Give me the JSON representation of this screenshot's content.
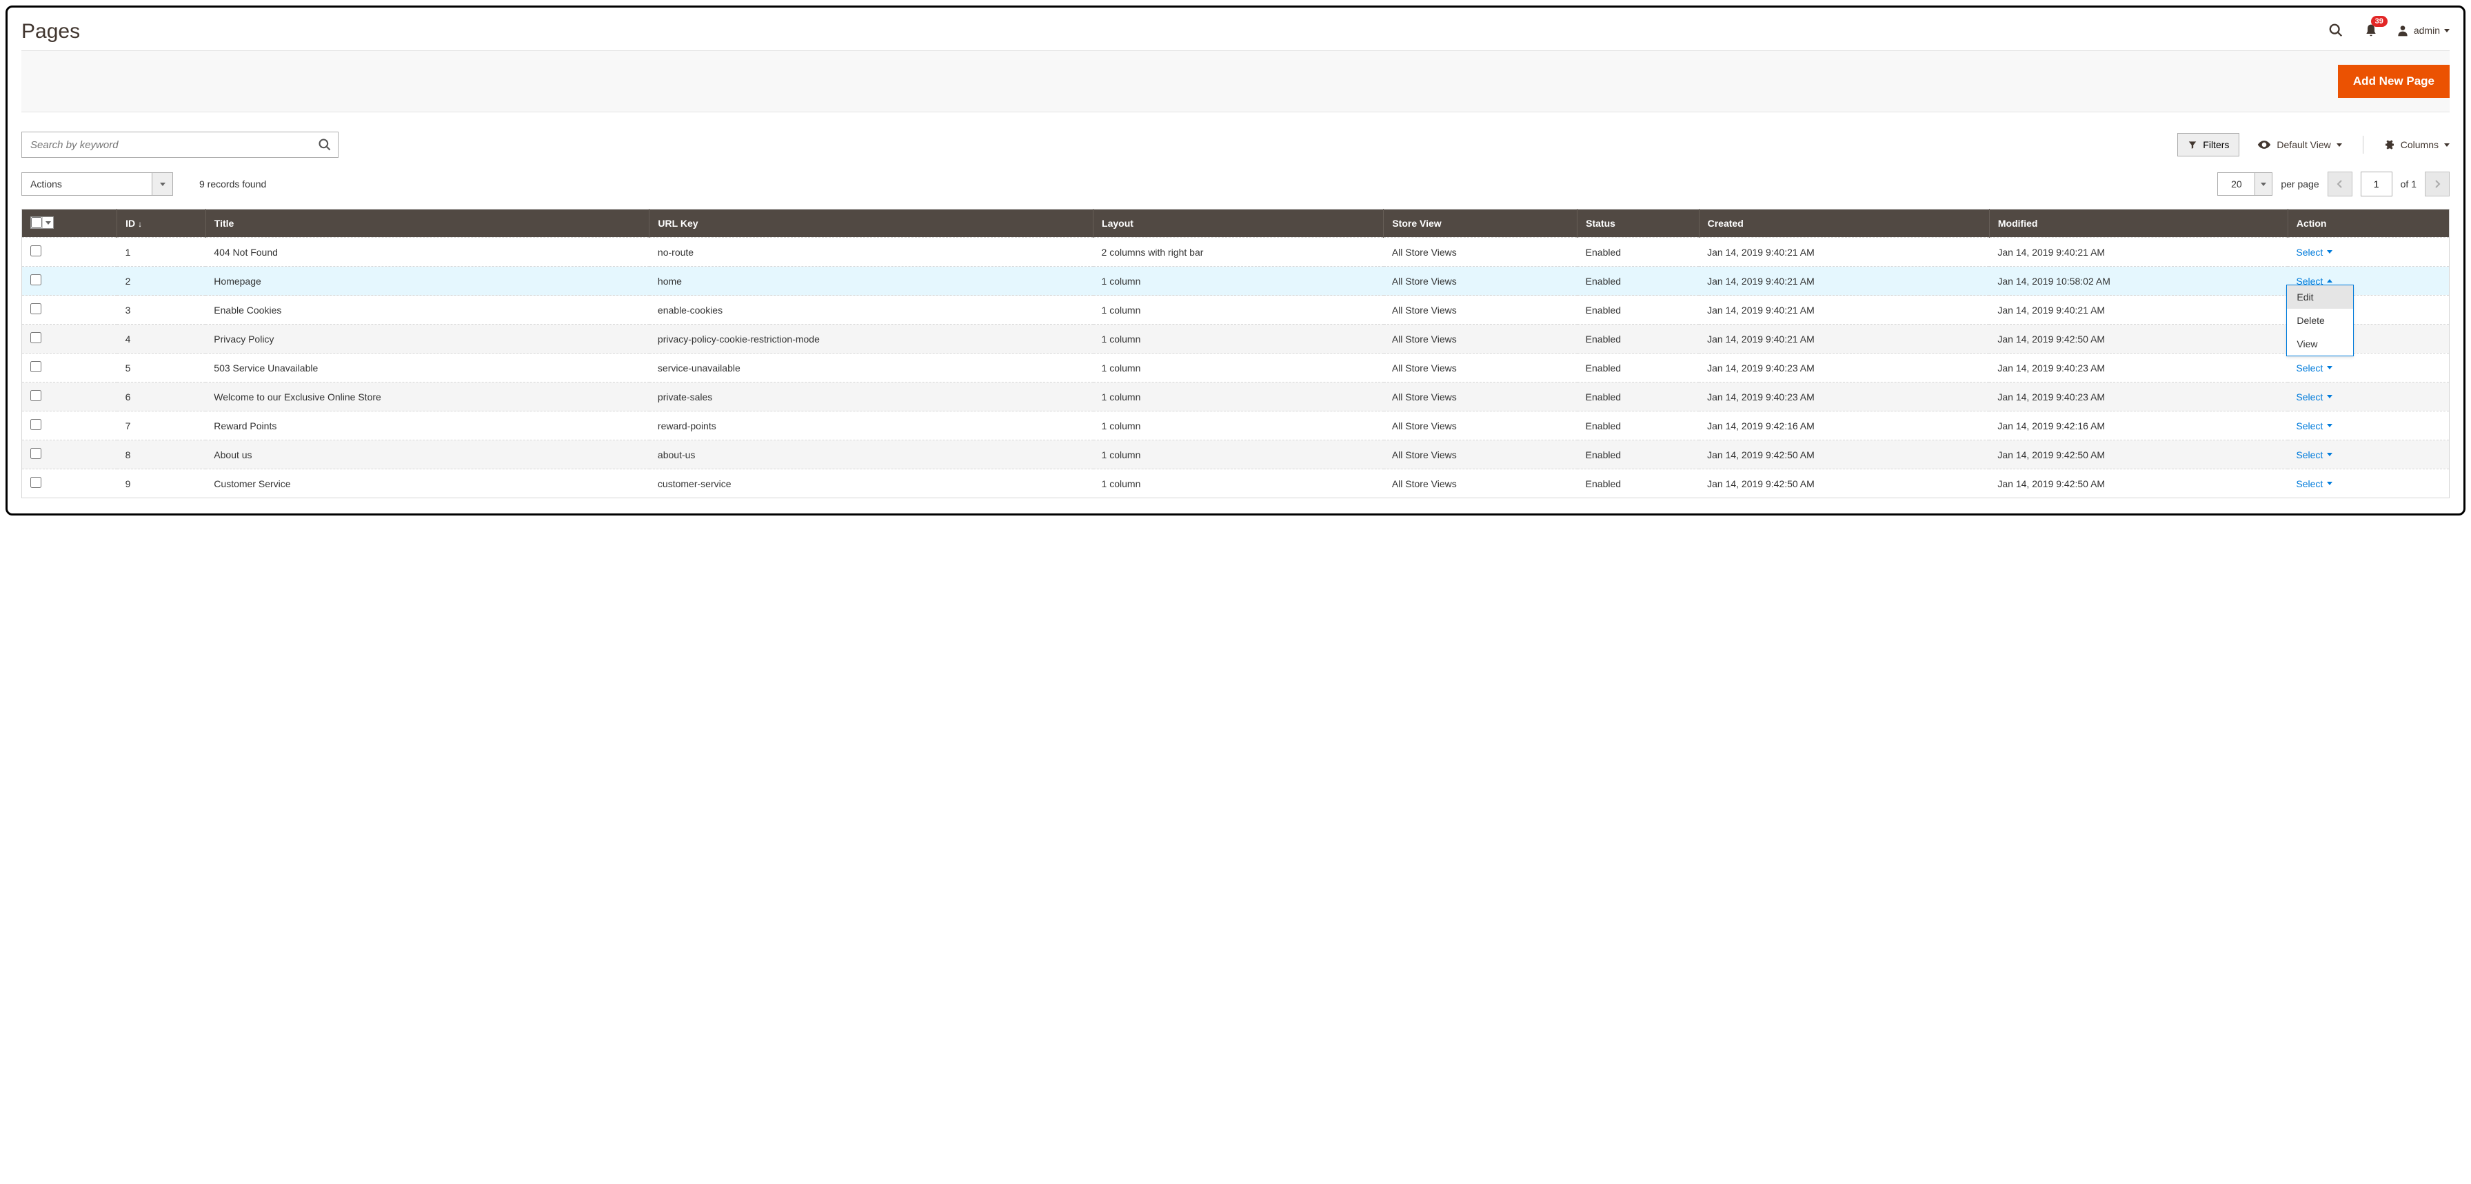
{
  "header": {
    "title": "Pages",
    "notifications": "39",
    "user": "admin"
  },
  "actionbar": {
    "add_button": "Add New Page"
  },
  "search": {
    "placeholder": "Search by keyword"
  },
  "controls": {
    "filters": "Filters",
    "default_view": "Default View",
    "columns": "Columns",
    "actions": "Actions",
    "records_found": "9 records found",
    "per_page_value": "20",
    "per_page_label": "per page",
    "page_current": "1",
    "page_total": "of 1"
  },
  "columns": {
    "id": "ID",
    "title": "Title",
    "url_key": "URL Key",
    "layout": "Layout",
    "store_view": "Store View",
    "status": "Status",
    "created": "Created",
    "modified": "Modified",
    "action": "Action"
  },
  "action_label": "Select",
  "dropdown": {
    "edit": "Edit",
    "delete": "Delete",
    "view": "View"
  },
  "rows": [
    {
      "id": "1",
      "title": "404 Not Found",
      "url": "no-route",
      "layout": "2 columns with right bar",
      "sv": "All Store Views",
      "status": "Enabled",
      "created": "Jan 14, 2019 9:40:21 AM",
      "modified": "Jan 14, 2019 9:40:21 AM"
    },
    {
      "id": "2",
      "title": "Homepage",
      "url": "home",
      "layout": "1 column",
      "sv": "All Store Views",
      "status": "Enabled",
      "created": "Jan 14, 2019 9:40:21 AM",
      "modified": "Jan 14, 2019 10:58:02 AM"
    },
    {
      "id": "3",
      "title": "Enable Cookies",
      "url": "enable-cookies",
      "layout": "1 column",
      "sv": "All Store Views",
      "status": "Enabled",
      "created": "Jan 14, 2019 9:40:21 AM",
      "modified": "Jan 14, 2019 9:40:21 AM"
    },
    {
      "id": "4",
      "title": "Privacy Policy",
      "url": "privacy-policy-cookie-restriction-mode",
      "layout": "1 column",
      "sv": "All Store Views",
      "status": "Enabled",
      "created": "Jan 14, 2019 9:40:21 AM",
      "modified": "Jan 14, 2019 9:42:50 AM"
    },
    {
      "id": "5",
      "title": "503 Service Unavailable",
      "url": "service-unavailable",
      "layout": "1 column",
      "sv": "All Store Views",
      "status": "Enabled",
      "created": "Jan 14, 2019 9:40:23 AM",
      "modified": "Jan 14, 2019 9:40:23 AM"
    },
    {
      "id": "6",
      "title": "Welcome to our Exclusive Online Store",
      "url": "private-sales",
      "layout": "1 column",
      "sv": "All Store Views",
      "status": "Enabled",
      "created": "Jan 14, 2019 9:40:23 AM",
      "modified": "Jan 14, 2019 9:40:23 AM"
    },
    {
      "id": "7",
      "title": "Reward Points",
      "url": "reward-points",
      "layout": "1 column",
      "sv": "All Store Views",
      "status": "Enabled",
      "created": "Jan 14, 2019 9:42:16 AM",
      "modified": "Jan 14, 2019 9:42:16 AM"
    },
    {
      "id": "8",
      "title": "About us",
      "url": "about-us",
      "layout": "1 column",
      "sv": "All Store Views",
      "status": "Enabled",
      "created": "Jan 14, 2019 9:42:50 AM",
      "modified": "Jan 14, 2019 9:42:50 AM"
    },
    {
      "id": "9",
      "title": "Customer Service",
      "url": "customer-service",
      "layout": "1 column",
      "sv": "All Store Views",
      "status": "Enabled",
      "created": "Jan 14, 2019 9:42:50 AM",
      "modified": "Jan 14, 2019 9:42:50 AM"
    }
  ]
}
